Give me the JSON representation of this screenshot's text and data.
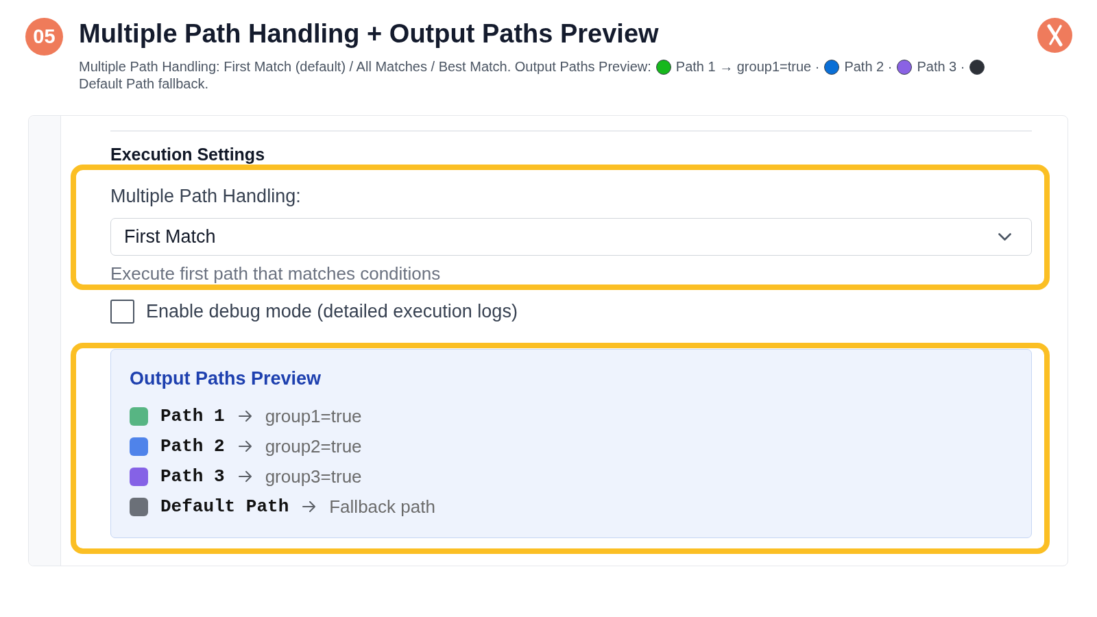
{
  "header": {
    "badge": "05",
    "title": "Multiple Path Handling + Output Paths Preview",
    "subtitle": [
      {
        "kind": "text",
        "text": "Multiple Path Handling: First Match (default) / All Matches / Best Match. Output Paths Preview:"
      },
      {
        "kind": "dot",
        "color": "#16b81c"
      },
      {
        "kind": "text",
        "text": "Path 1 → group1=true ·"
      },
      {
        "kind": "dot",
        "color": "#0a6fd6"
      },
      {
        "kind": "text",
        "text": "Path 2 ·"
      },
      {
        "kind": "dot",
        "color": "#8a62e4"
      },
      {
        "kind": "text",
        "text": "Path 3 ·"
      },
      {
        "kind": "dot",
        "color": "#2d3138"
      },
      {
        "kind": "text",
        "text": "Default Path fallback."
      }
    ]
  },
  "settings": {
    "heading": "Execution Settings",
    "path_handling": {
      "highlighted": true,
      "label": "Multiple Path Handling:",
      "value": "First Match",
      "help_text": "Execute first path that matches conditions"
    },
    "debug_mode": {
      "label": "Enable debug mode (detailed execution logs)",
      "checked": false
    }
  },
  "preview": {
    "highlighted": true,
    "title": "Output Paths Preview",
    "paths": [
      {
        "name": "Path 1",
        "condition": "group1=true",
        "color": "#57b583"
      },
      {
        "name": "Path 2",
        "condition": "group2=true",
        "color": "#4f83ea"
      },
      {
        "name": "Path 3",
        "condition": "group3=true",
        "color": "#8562e6"
      },
      {
        "name": "Default Path",
        "condition": "Fallback path",
        "color": "#6b7078"
      }
    ]
  }
}
